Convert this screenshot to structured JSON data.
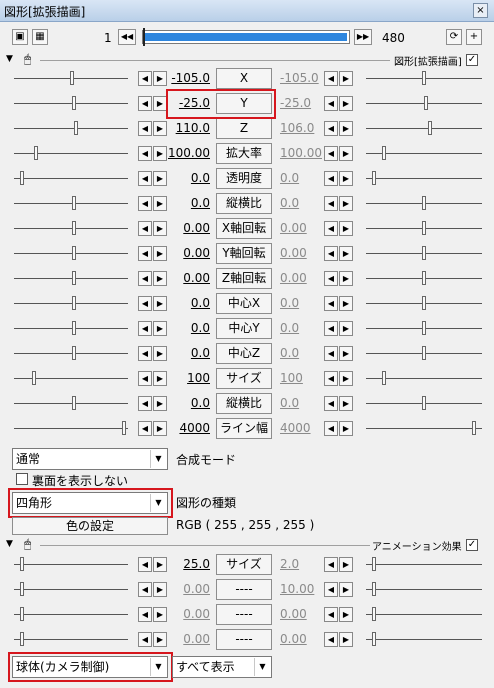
{
  "window": {
    "title": "図形[拡張描画]",
    "close_glyph": "×"
  },
  "toolbar": {
    "frame_start": "1",
    "frame_end": "480",
    "cam_icon": "camera-icon",
    "plus": "+"
  },
  "section1": {
    "label": "図形[拡張描画]",
    "checked": "✓"
  },
  "params": [
    {
      "left": "-105.0",
      "name": "X",
      "right": "-105.0"
    },
    {
      "left": "-25.0",
      "name": "Y",
      "right": "-25.0"
    },
    {
      "left": "110.0",
      "name": "Z",
      "right": "106.0"
    },
    {
      "left": "100.00",
      "name": "拡大率",
      "right": "100.00"
    },
    {
      "left": "0.0",
      "name": "透明度",
      "right": "0.0"
    },
    {
      "left": "0.0",
      "name": "縦横比",
      "right": "0.0"
    },
    {
      "left": "0.00",
      "name": "X軸回転",
      "right": "0.00"
    },
    {
      "left": "0.00",
      "name": "Y軸回転",
      "right": "0.00"
    },
    {
      "left": "0.00",
      "name": "Z軸回転",
      "right": "0.00"
    },
    {
      "left": "0.0",
      "name": "中心X",
      "right": "0.0"
    },
    {
      "left": "0.0",
      "name": "中心Y",
      "right": "0.0"
    },
    {
      "left": "0.0",
      "name": "中心Z",
      "right": "0.0"
    },
    {
      "left": "100",
      "name": "サイズ",
      "right": "100"
    },
    {
      "left": "0.0",
      "name": "縦横比",
      "right": "0.0"
    },
    {
      "left": "4000",
      "name": "ライン幅",
      "right": "4000"
    }
  ],
  "blend": {
    "value": "通常",
    "label": "合成モード"
  },
  "backface": {
    "label": "裏面を表示しない"
  },
  "shape": {
    "value": "四角形",
    "label": "図形の種類"
  },
  "color": {
    "button": "色の設定",
    "value": "RGB ( 255 , 255 , 255 )"
  },
  "section2": {
    "label": "アニメーション効果",
    "checked": "✓"
  },
  "anim_params": [
    {
      "left": "25.0",
      "name": "サイズ",
      "right": "2.0"
    },
    {
      "left": "0.00",
      "name": "----",
      "right": "10.00"
    },
    {
      "left": "0.00",
      "name": "----",
      "right": "0.00"
    },
    {
      "left": "0.00",
      "name": "----",
      "right": "0.00"
    }
  ],
  "effect": {
    "value": "球体(カメラ制御)",
    "option": "すべて表示"
  },
  "glyphs": {
    "left_arrow": "◀",
    "right_arrow": "▶",
    "dropdown": "▼",
    "collapse": "▼",
    "mouse": "🖱",
    "skip_left": "◀◀",
    "skip_right": "▶▶"
  }
}
